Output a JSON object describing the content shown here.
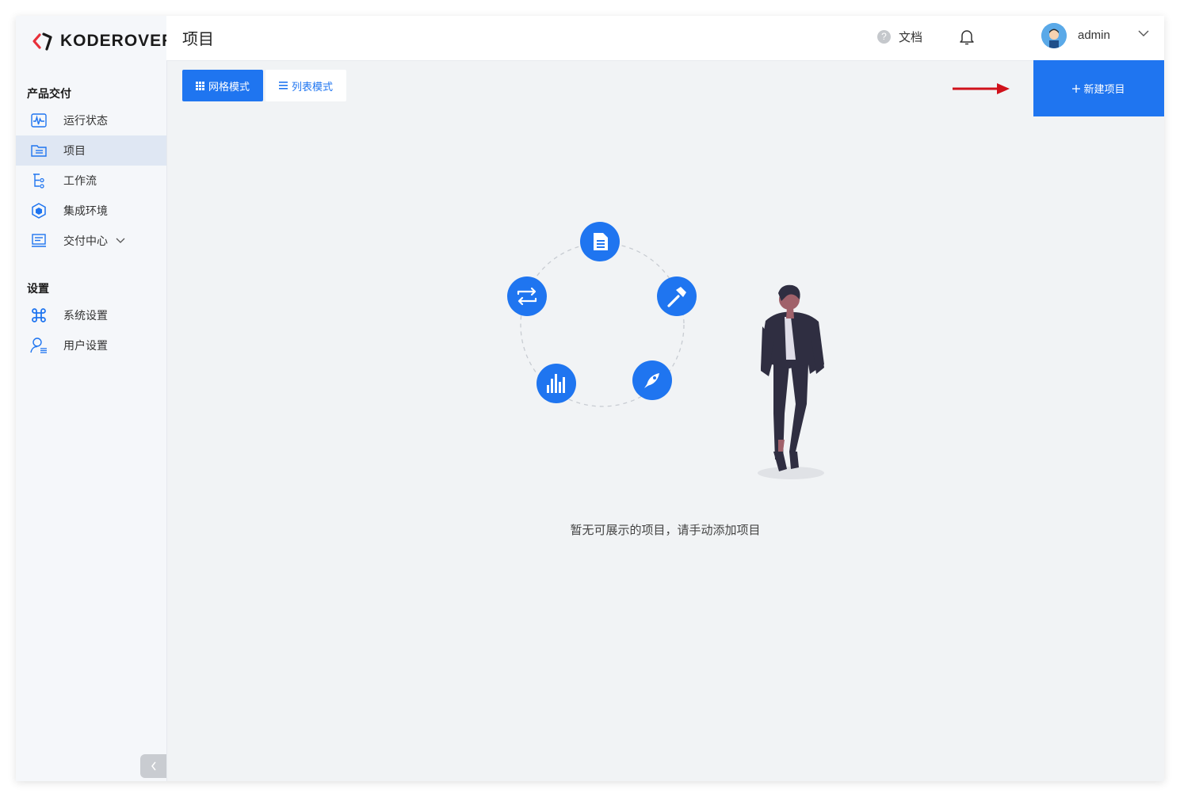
{
  "brand": {
    "name": "KODEROVER",
    "accent": "#e8303a"
  },
  "sidebar": {
    "sections": [
      {
        "title": "产品交付"
      },
      {
        "title": "设置"
      }
    ],
    "items": [
      {
        "label": "运行状态",
        "icon": "pulse-icon"
      },
      {
        "label": "项目",
        "icon": "folder-list-icon",
        "active": true
      },
      {
        "label": "工作流",
        "icon": "workflow-icon"
      },
      {
        "label": "集成环境",
        "icon": "cube-icon"
      },
      {
        "label": "交付中心",
        "icon": "delivery-icon",
        "expandable": true
      },
      {
        "label": "系统设置",
        "icon": "command-icon"
      },
      {
        "label": "用户设置",
        "icon": "user-settings-icon"
      }
    ]
  },
  "header": {
    "title": "项目",
    "docs_label": "文档",
    "username": "admin"
  },
  "toolbar": {
    "grid_mode_label": "网格模式",
    "list_mode_label": "列表模式",
    "new_project_label": "新建项目"
  },
  "empty_state": {
    "message": "暂无可展示的项目，请手动添加项目"
  },
  "colors": {
    "primary": "#1f75f0",
    "annotation_arrow": "#d0111b"
  }
}
